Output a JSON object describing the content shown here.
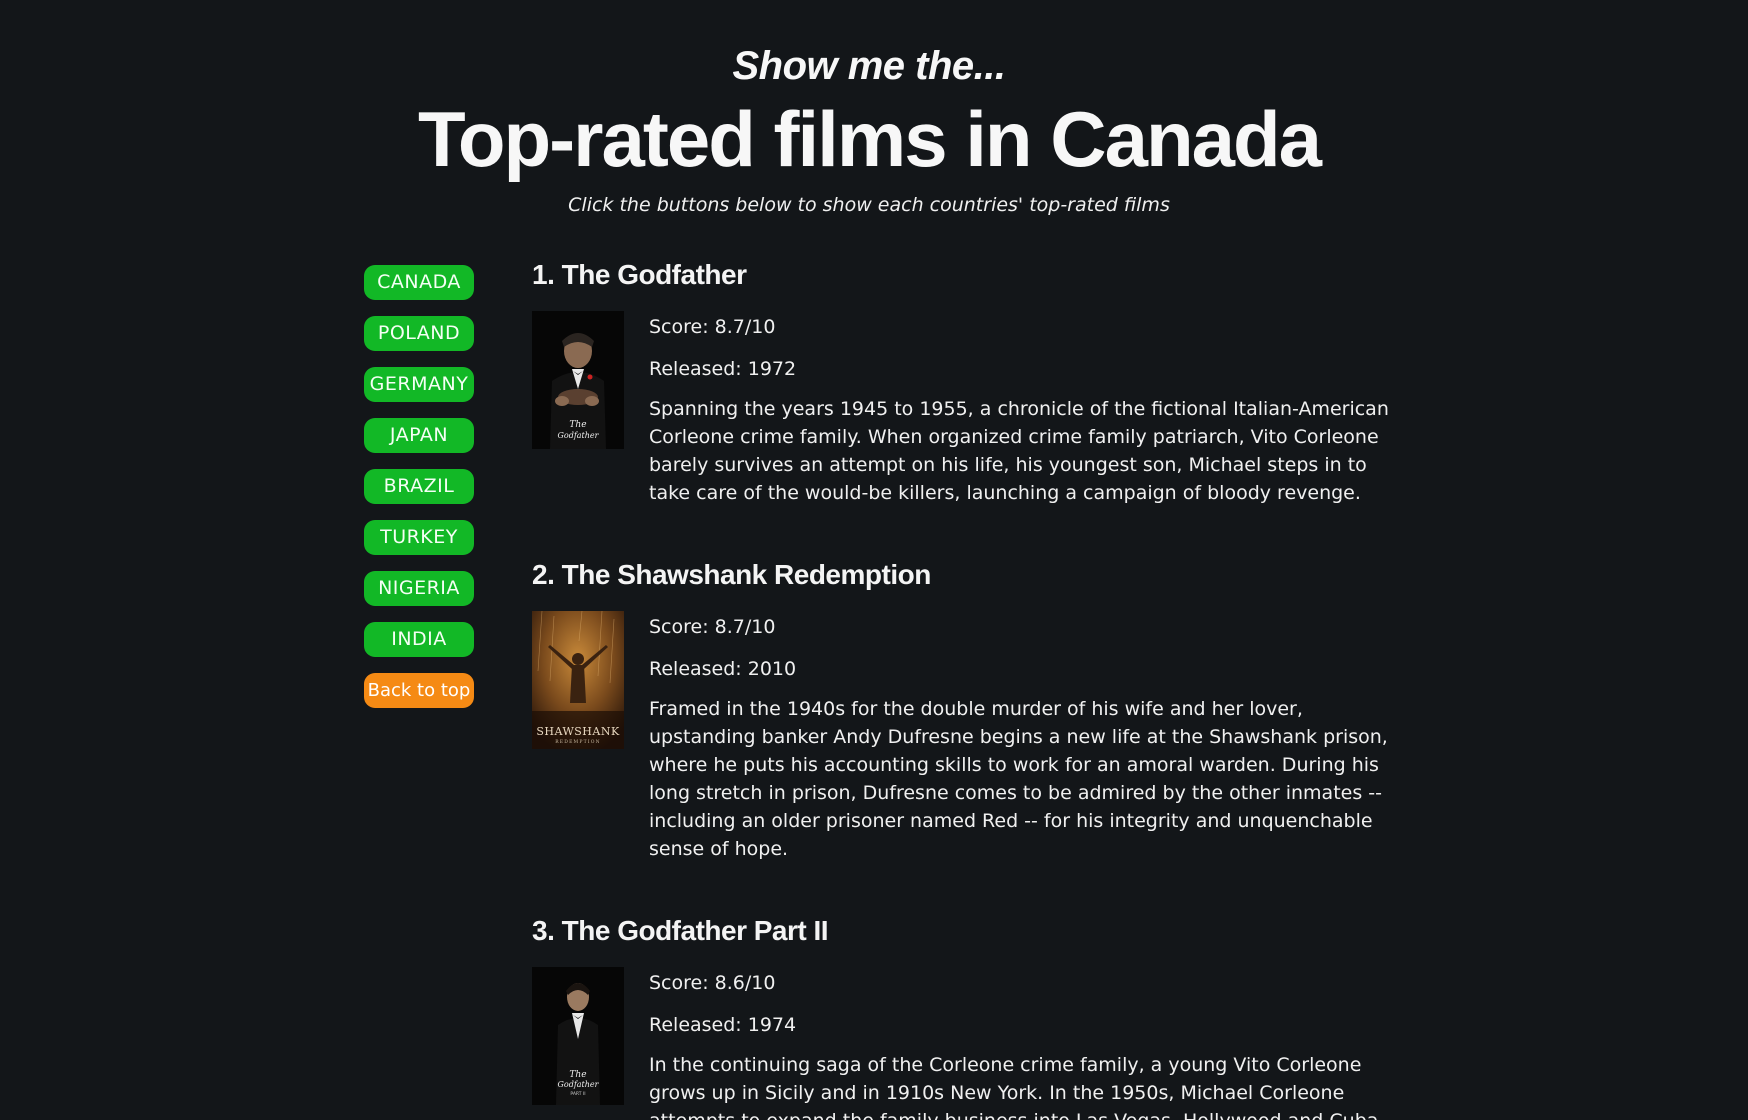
{
  "header": {
    "kicker": "Show me the...",
    "title": "Top-rated films in Canada",
    "subtitle": "Click the buttons below to show each countries' top-rated films"
  },
  "sidebar": {
    "countries": [
      "CANADA",
      "POLAND",
      "GERMANY",
      "JAPAN",
      "BRAZIL",
      "TURKEY",
      "NIGERIA",
      "INDIA"
    ],
    "back_to_top": "Back to top"
  },
  "films": [
    {
      "title": "1. The Godfather",
      "score": "Score: 8.7/10",
      "released": "Released: 1972",
      "description": "Spanning the years 1945 to 1955, a chronicle of the fictional Italian-American Corleone crime family. When organized crime family patriarch, Vito Corleone barely survives an attempt on his life, his youngest son, Michael steps in to take care of the would-be killers, launching a campaign of bloody revenge.",
      "poster_text": "The Godfather"
    },
    {
      "title": "2. The Shawshank Redemption",
      "score": "Score: 8.7/10",
      "released": "Released: 2010",
      "description": "Framed in the 1940s for the double murder of his wife and her lover, upstanding banker Andy Dufresne begins a new life at the Shawshank prison, where he puts his accounting skills to work for an amoral warden. During his long stretch in prison, Dufresne comes to be admired by the other inmates -- including an older prisoner named Red -- for his integrity and unquenchable sense of hope.",
      "poster_text": "SHAWSHANK"
    },
    {
      "title": "3. The Godfather Part II",
      "score": "Score: 8.6/10",
      "released": "Released: 1974",
      "description": "In the continuing saga of the Corleone crime family, a young Vito Corleone grows up in Sicily and in 1910s New York. In the 1950s, Michael Corleone attempts to expand the family business into Las Vegas, Hollywood and Cuba.",
      "poster_text": "The Godfather"
    }
  ],
  "colors": {
    "background": "#131619",
    "country_button": "#12b826",
    "back_to_top_button": "#f58a14"
  }
}
